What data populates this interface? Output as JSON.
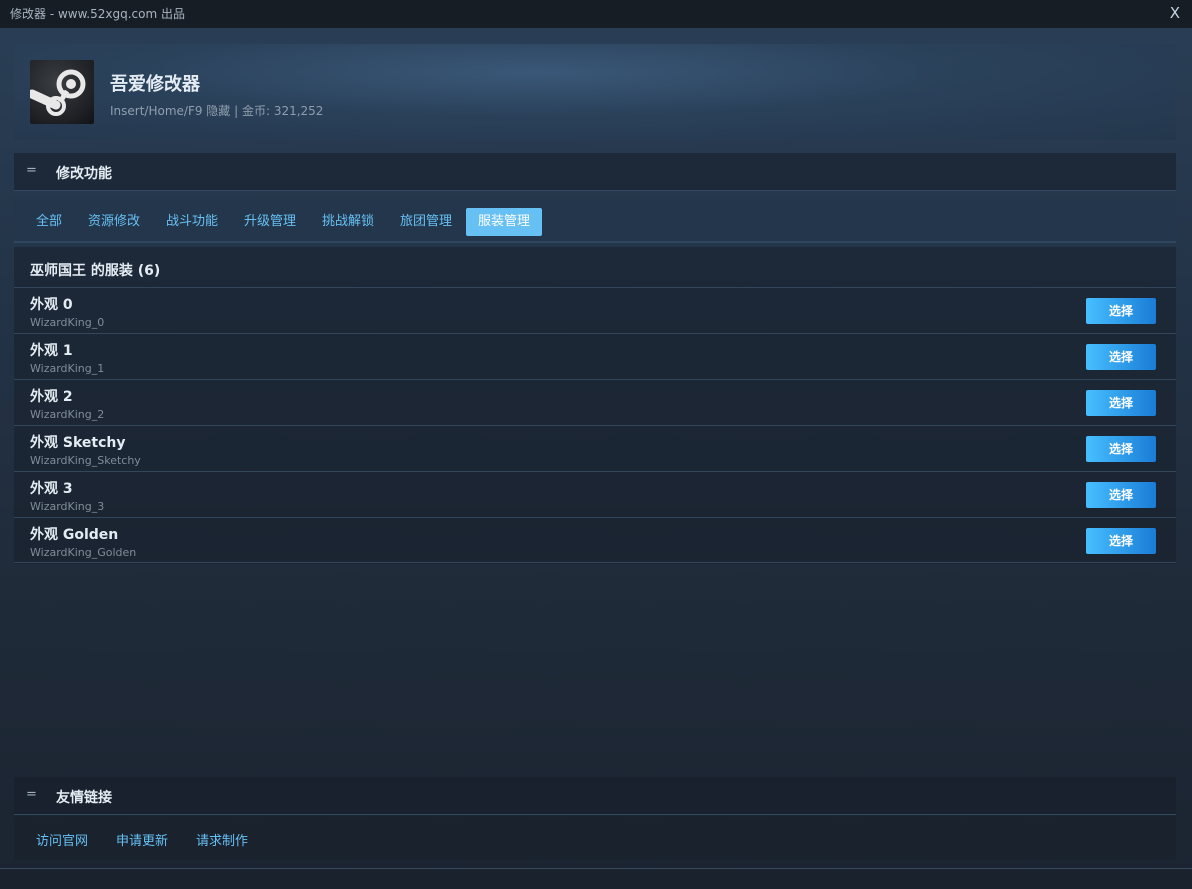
{
  "window": {
    "title": "修改器 - www.52xgq.com 出品",
    "close_label": "X"
  },
  "header": {
    "app_name": "吾爱修改器",
    "subtitle": "Insert/Home/F9 隐藏 | 金币: 321,252",
    "logo_icon": "steam-logo-icon"
  },
  "functions_section": {
    "menu_icon": "=",
    "title": "修改功能",
    "tabs": [
      {
        "label": "全部",
        "active": false
      },
      {
        "label": "资源修改",
        "active": false
      },
      {
        "label": "战斗功能",
        "active": false
      },
      {
        "label": "升级管理",
        "active": false
      },
      {
        "label": "挑战解锁",
        "active": false
      },
      {
        "label": "旅团管理",
        "active": false
      },
      {
        "label": "服装管理",
        "active": true
      }
    ]
  },
  "costume_list": {
    "title": "巫师国王 的服装 (6)",
    "select_label": "选择",
    "items": [
      {
        "name": "外观 0",
        "id": "WizardKing_0"
      },
      {
        "name": "外观 1",
        "id": "WizardKing_1"
      },
      {
        "name": "外观 2",
        "id": "WizardKing_2"
      },
      {
        "name": "外观 Sketchy",
        "id": "WizardKing_Sketchy"
      },
      {
        "name": "外观 3",
        "id": "WizardKing_3"
      },
      {
        "name": "外观 Golden",
        "id": "WizardKing_Golden"
      }
    ]
  },
  "links_section": {
    "menu_icon": "=",
    "title": "友情链接",
    "links": [
      {
        "label": "访问官网"
      },
      {
        "label": "申请更新"
      },
      {
        "label": "请求制作"
      }
    ]
  },
  "colors": {
    "accent": "#66c0f4",
    "button_start": "#47bfff",
    "button_end": "#1a7cd6",
    "titlebar": "#171d25"
  }
}
